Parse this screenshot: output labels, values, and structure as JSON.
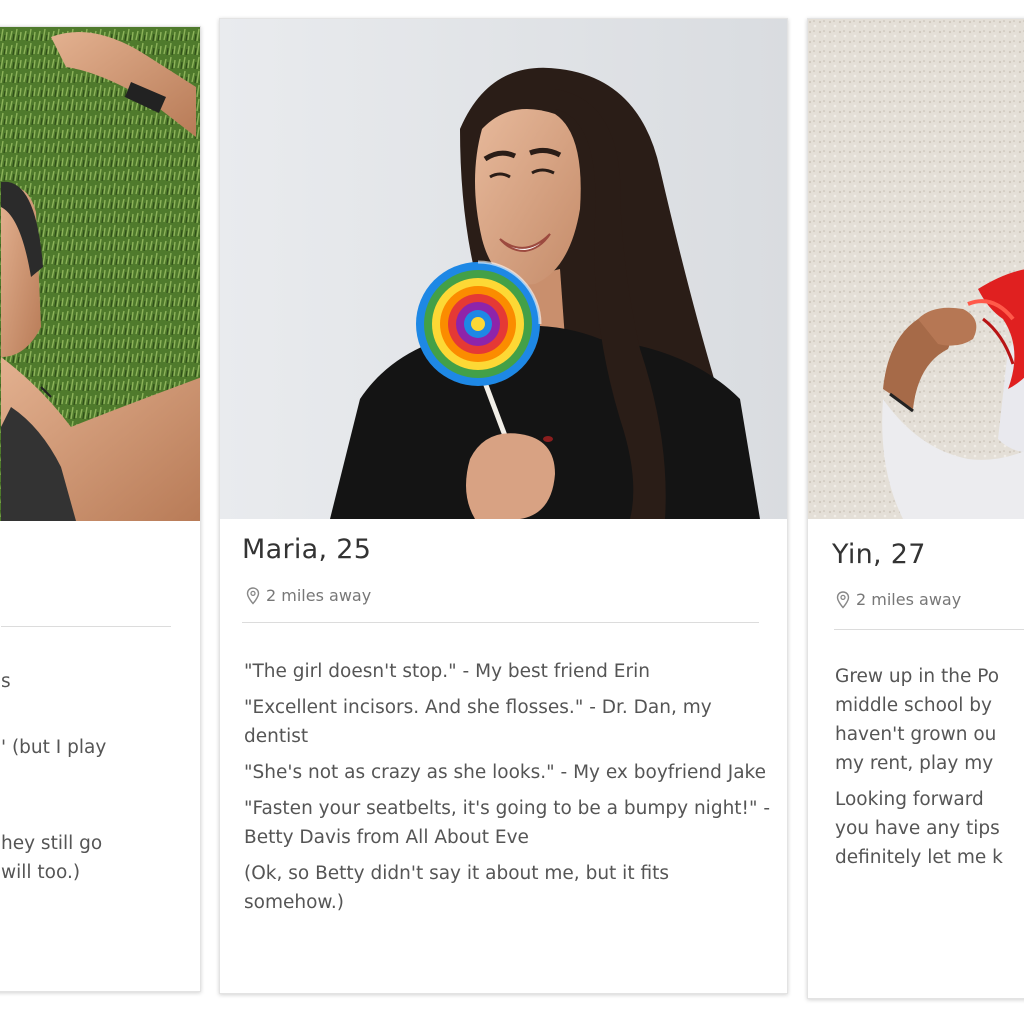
{
  "profiles": [
    {
      "position": "left",
      "bio_fragments": [
        "s",
        "' (but I play",
        "hey still go",
        " will too.)"
      ]
    },
    {
      "position": "center",
      "name": "Maria, 25",
      "distance": "2 miles away",
      "bio": [
        "\"The girl doesn't stop.\" - My best friend Erin",
        "\"Excellent incisors. And she flosses.\" - Dr. Dan, my dentist",
        "\"She's not as crazy as she looks.\" - My ex boyfriend Jake",
        "\"Fasten your seatbelts, it's going to be a bumpy night!\" - Betty Davis from All About Eve",
        "(Ok, so Betty didn't say it about me, but it fits somehow.)"
      ]
    },
    {
      "position": "right",
      "name": "Yin, 27",
      "distance": "2 miles away",
      "bio": [
        "Grew up in the Po middle school by haven't grown ou my rent, play my",
        "Looking forward you have any tips definitely let me k"
      ]
    }
  ],
  "icons": {
    "location": "map-pin-icon"
  },
  "colors": {
    "card_border": "#e3e3e3",
    "name_text": "#333333",
    "muted_text": "#777777",
    "bio_text": "#555555",
    "lollipop": [
      "#e53935",
      "#fb8c00",
      "#fdd835",
      "#43a047",
      "#1e88e5",
      "#8e24aa"
    ],
    "hair_red": "#e02020"
  }
}
